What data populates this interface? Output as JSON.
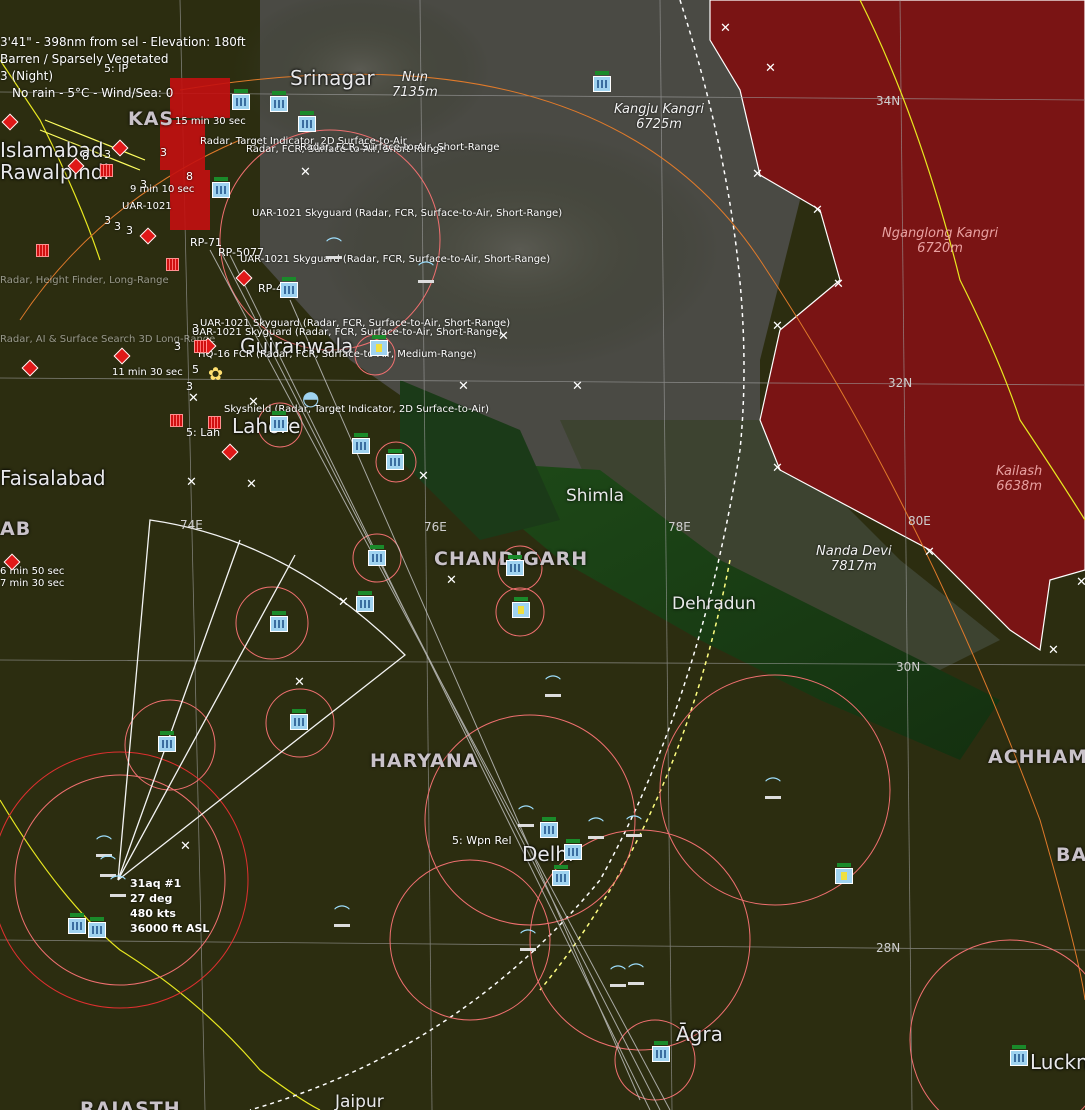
{
  "cursor_info": {
    "line1": "3'41\" - 398nm from sel - Elevation: 180ft",
    "line2": "Barren / Sparsely Vegetated",
    "line3": "3 (Night)",
    "line4": "No rain - 5°C - Wind/Sea: 0"
  },
  "cities": {
    "srinagar": "Srinagar",
    "lahore": "Lahore",
    "gujranwala": "Gujranwala",
    "rawalpindi": "Rawalpindi",
    "islamabad": "Islamabad",
    "shimla": "Shimla",
    "dehradun": "Dehradun",
    "delhi": "Delhi",
    "agra": "Āgra",
    "lucknow": "Luckno",
    "jaipur": "Jaipur",
    "faisalabad": "Faisalabad"
  },
  "states": {
    "chandigarh": "CHANDIGARH",
    "haryana": "HARYANA",
    "achham": "ACHHAM",
    "ba": "BA",
    "kas": "KAS",
    "ab": "AB",
    "rajasthan": "RAJASTH"
  },
  "peaks": [
    {
      "name": "Nun",
      "height": "7135m"
    },
    {
      "name": "Kangju Kangri",
      "height": "6725m"
    },
    {
      "name": "Nganglong Kangri",
      "height": "6720m"
    },
    {
      "name": "Kailash",
      "height": "6638m"
    },
    {
      "name": "Nanda Devi",
      "height": "7817m"
    }
  ],
  "grid_labels": {
    "lat34": "34N",
    "lat32": "32N",
    "lat30": "30N",
    "lat28": "28N",
    "lon74": "74E",
    "lon76": "76E",
    "lon78": "78E",
    "lon80": "80E"
  },
  "reference_points": {
    "ip": "5: IP",
    "wpn_rel": "5: Wpn Rel",
    "rp_5077": "RP-5077",
    "rp_4": "RP-4",
    "rp_71": "RP-71",
    "lahore_5": "5: Lah"
  },
  "timers": {
    "t1": "15 min 30 sec",
    "t2": "9 min 10 sec",
    "t3": "11 min 30 sec",
    "t4": "6 min 50 sec",
    "t5": "7 min 30 sec"
  },
  "unit_labels": {
    "u1": "Radar, Target Indicator, 2D Surface-to-Air",
    "u2": "Radar, FCR, Surface-to-Air, Short-Range",
    "u3": "UAR-1021 Skyguard (Radar, FCR, Surface-to-Air, Short-Range)",
    "u4": "UAR-1021 Skyguard (Radar, FCR, Surface-to-Air, Short-Range)",
    "u5": "UAR-1021 Skyguard (Radar, FCR, Surface-to-Air, Short-Range)",
    "u6": "UAR-1021 Skyguard (Radar, FCR, Surface-to-Air, Short-Range)",
    "u7": "HQ-16 FCR (Radar, FCR, Surface-to-Air, Medium-Range)",
    "u8": "Skyshield (Radar, Target Indicator, 2D Surface-to-Air)",
    "u9": "Radar, AI & Surface Search 3D Long-Range",
    "u10": "Radar, Height Finder, Long-Range",
    "u11": "UAR-1021",
    "u12": "Radar, FCR, Surface-to-Air, Short-Range"
  },
  "aircraft": {
    "callsign": "31aq #1",
    "heading": "27 deg",
    "speed": "480 kts",
    "altitude": "36000 ft ASL"
  },
  "stack_digits": [
    "3",
    "3",
    "3",
    "3",
    "3",
    "3",
    "3",
    "8",
    "8",
    "3",
    "5",
    "3"
  ],
  "colors": {
    "hostile": "#e01818",
    "friendly": "#9fd3f0",
    "range_ring": "#f07070",
    "border": "#e8e820",
    "restricted_zone": "#7a1414",
    "terrain": "#2a2c0e"
  }
}
